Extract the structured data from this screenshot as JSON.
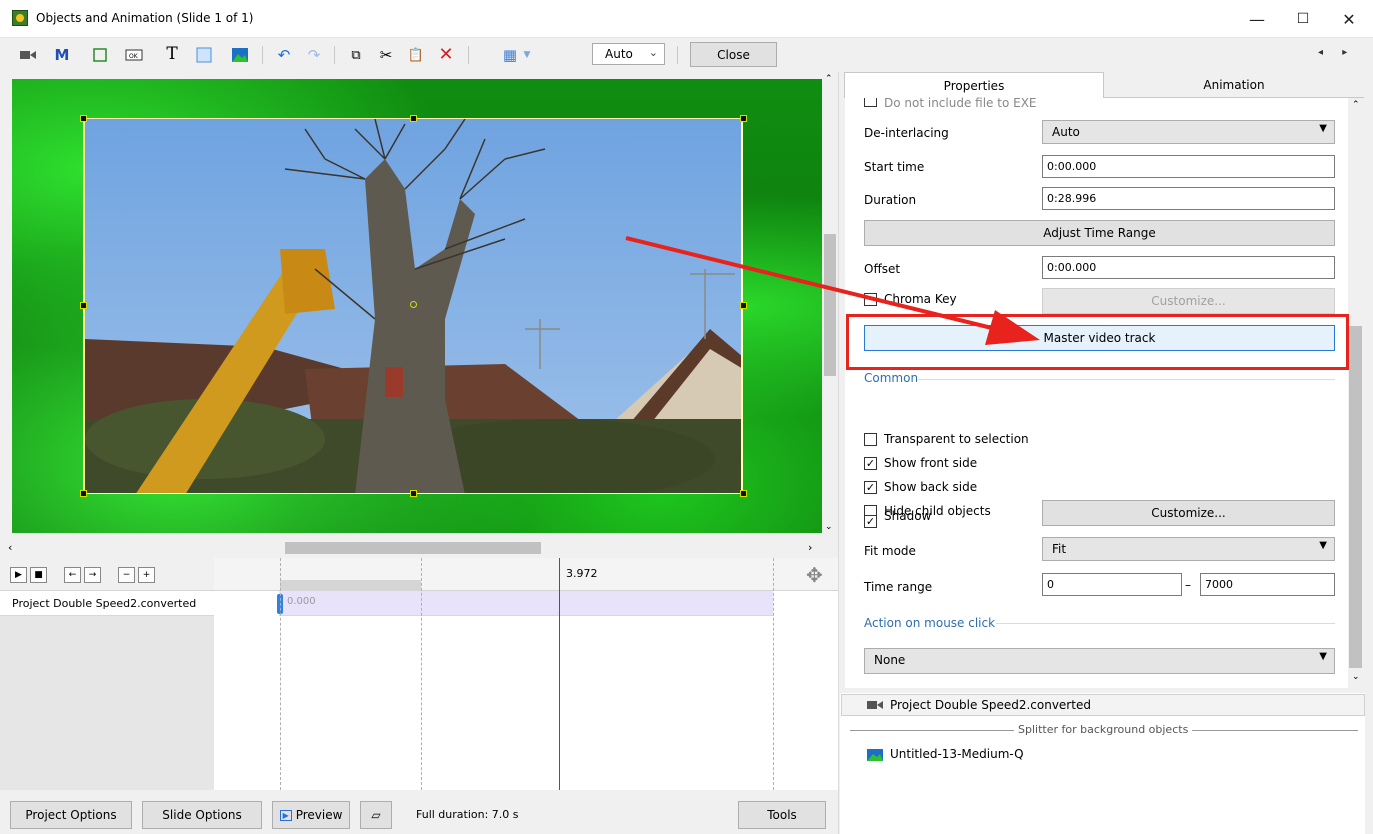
{
  "window": {
    "title": "Objects and Animation (Slide 1 of 1)",
    "minimize": "—",
    "maximize": "☐",
    "close": "✕"
  },
  "toolbar": {
    "zoom_value": "Auto",
    "close_label": "Close",
    "nav": "◂ ▸"
  },
  "timeline": {
    "ruler_time": "3.972",
    "track_name": "Project Double Speed2.converted",
    "clip_start": "0.000"
  },
  "bottom": {
    "project_options": "Project Options",
    "slide_options": "Slide Options",
    "preview": "Preview",
    "full_duration": "Full duration: 7.0 s",
    "tools": "Tools"
  },
  "tabs": {
    "properties": "Properties",
    "animation": "Animation"
  },
  "properties": {
    "cut_off_label": "Do not include file to EXE",
    "deinterlacing_label": "De-interlacing",
    "deinterlacing_value": "Auto",
    "start_time_label": "Start time",
    "start_time_value": "0:00.000",
    "duration_label": "Duration",
    "duration_value": "0:28.996",
    "adjust_time_range": "Adjust Time Range",
    "offset_label": "Offset",
    "offset_value": "0:00.000",
    "chroma_key_label": "Chroma Key",
    "chroma_customize": "Customize...",
    "master_video_track": "Master video track",
    "common_section": "Common",
    "transparent_label": "Transparent to selection",
    "show_front_label": "Show front side",
    "show_back_label": "Show back side",
    "hide_child_label": "Hide child objects",
    "shadow_label": "Shadow",
    "shadow_customize": "Customize...",
    "fit_mode_label": "Fit mode",
    "fit_mode_value": "Fit",
    "time_range_label": "Time range",
    "time_range_from": "0",
    "time_range_dash": "–",
    "time_range_to": "7000",
    "action_section": "Action on mouse click",
    "action_value": "None"
  },
  "checkbox_state": {
    "transparent": "",
    "show_front": "✓",
    "show_back": "✓",
    "hide_child": "",
    "shadow": "✓",
    "chroma_key": "",
    "cut_off": ""
  },
  "objects": {
    "video_object": "Project Double Speed2.converted",
    "splitter": "Splitter for background objects",
    "background_object": "Untitled-13-Medium-Q"
  },
  "colors": {
    "accent_blue": "#2f6db3",
    "highlight_red": "#e8221c",
    "playhead_red": "#d21f1f"
  }
}
